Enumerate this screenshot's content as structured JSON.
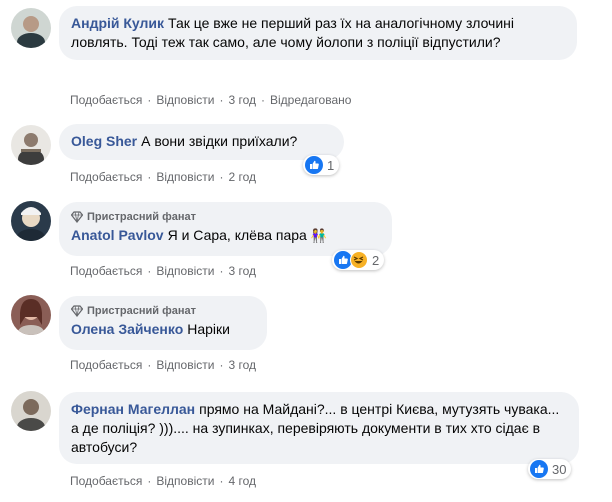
{
  "common": {
    "like_label": "Подобається",
    "reply_label": "Відповісти",
    "separator": "·",
    "fan_badge": "Пристрасний фанат"
  },
  "comments": [
    {
      "author": "Андрій Кулик",
      "text": "Так це вже не перший раз їх на аналогічному злочині ловлять. Тоді теж так само, але чому йолопи з поліції відпустили?",
      "time": "3 год",
      "edited": "Відредаговано"
    },
    {
      "author": "Oleg Sher",
      "text": "А вони звідки приїхали?",
      "time": "2 год",
      "reaction_count": "1",
      "reaction_icons": [
        "like-icon"
      ]
    },
    {
      "author": "Anatol Pavlov",
      "text": "Я и Сара, клёва пара",
      "emoji": "👫",
      "time": "3 год",
      "reaction_count": "2",
      "reaction_icons": [
        "like-icon",
        "haha-icon"
      ]
    },
    {
      "author": "Олена Зайченко",
      "text": "Наріки",
      "time": "3 год"
    },
    {
      "author": "Фернан Магеллан",
      "text": "прямо на Майдані?... в центрі Києва, мутузять чувака... а де поліція? ))).... на зупинках, перевіряють документи в тих хто сідає в автобуси?",
      "time": "4 год",
      "reaction_count": "30",
      "reaction_icons": [
        "like-icon"
      ]
    }
  ],
  "colors": {
    "author_link": "#385898",
    "bubble_bg": "#f0f2f5",
    "meta_text": "#65676b",
    "like_blue": "#1877f2"
  }
}
